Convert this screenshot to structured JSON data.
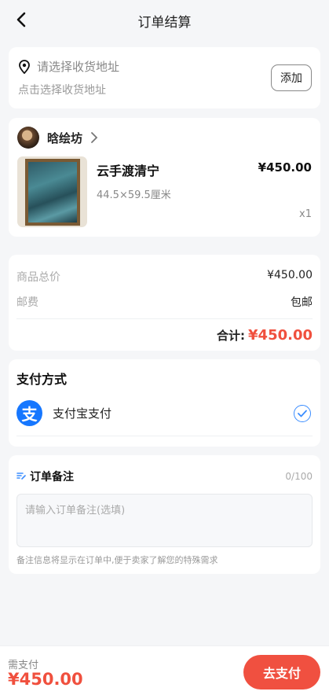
{
  "header": {
    "title": "订单结算"
  },
  "address": {
    "placeholder": "请选择收货地址",
    "sub": "点击选择收货地址",
    "add_label": "添加"
  },
  "shop": {
    "name": "晗绘坊",
    "product": {
      "name": "云手渡清宁",
      "spec": "44.5×59.5厘米",
      "price": "¥450.00",
      "qty": "x1"
    }
  },
  "summary": {
    "goods_label": "商品总价",
    "goods_value": "¥450.00",
    "shipping_label": "邮费",
    "shipping_value": "包邮",
    "total_label": "合计:",
    "total_value": "¥450.00"
  },
  "payment": {
    "title": "支付方式",
    "method": "支付宝支付",
    "method_icon_text": "支",
    "selected": true
  },
  "remark": {
    "title": "订单备注",
    "count": "0/100",
    "placeholder": "请输入订单备注(选填)",
    "hint": "备注信息将显示在订单中,便于卖家了解您的特殊需求"
  },
  "footer": {
    "due_label": "需支付",
    "due_amount": "¥450.00",
    "pay_button": "去支付"
  },
  "colors": {
    "accent": "#f0503e",
    "alipay": "#1677ff",
    "check": "#3b8dff"
  }
}
